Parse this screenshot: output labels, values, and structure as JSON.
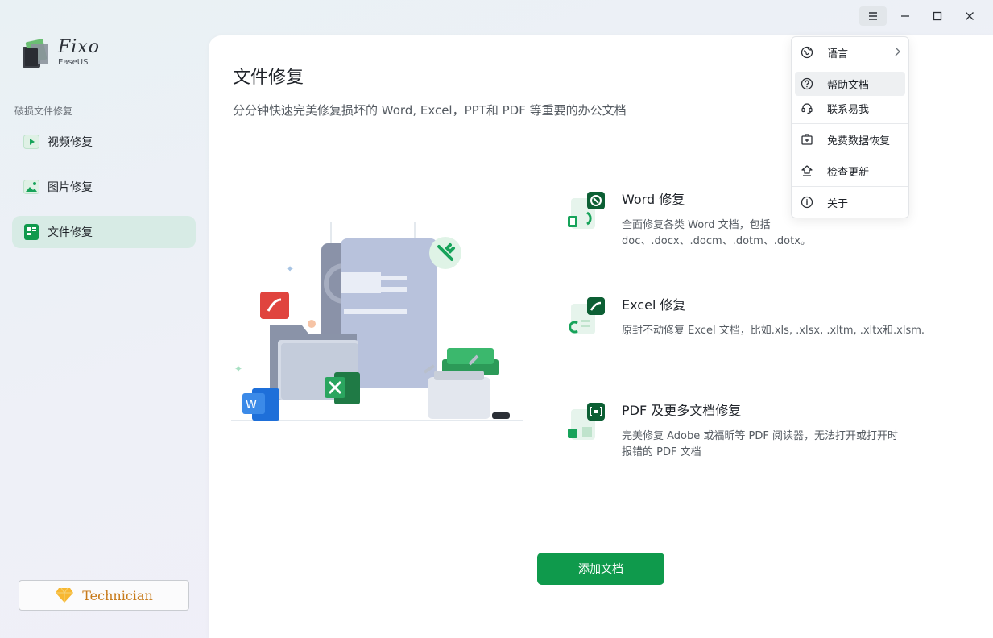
{
  "app": {
    "logo_title": "Fixo",
    "logo_sub": "EaseUS"
  },
  "sidebar": {
    "section_label": "破损文件修复",
    "items": [
      {
        "label": "视频修复",
        "icon": "video-icon"
      },
      {
        "label": "图片修复",
        "icon": "image-icon"
      },
      {
        "label": "文件修复",
        "icon": "document-icon"
      }
    ],
    "technician_label": "Technician"
  },
  "main": {
    "title": "文件修复",
    "subtitle": "分分钟快速完美修复损坏的 Word, Excel，PPT和 PDF 等重要的办公文档",
    "features": [
      {
        "title": "Word 修复",
        "desc_line1": "全面修复各类 Word 文档，包括",
        "desc_line2": "doc、.docx、.docm、.dotm、.dotx。"
      },
      {
        "title": "Excel 修复",
        "desc_line1": "原封不动修复 Excel 文档，比如.xls, .xlsx, .xltm, .xltx和.xlsm.",
        "desc_line2": ""
      },
      {
        "title": "PDF 及更多文档修复",
        "desc_line1": "完美修复 Adobe 或福昕等 PDF 阅读器，无法打开或打开时",
        "desc_line2": "报错的 PDF 文档"
      }
    ],
    "add_button": "添加文档"
  },
  "menu": {
    "items": [
      {
        "label": "语言",
        "icon": "globe-icon"
      },
      {
        "label": "帮助文档",
        "icon": "help-icon"
      },
      {
        "label": "联系易我",
        "icon": "headset-icon"
      },
      {
        "label": "免费数据恢复",
        "icon": "recovery-icon"
      },
      {
        "label": "检查更新",
        "icon": "update-icon"
      },
      {
        "label": "关于",
        "icon": "info-icon"
      }
    ]
  },
  "colors": {
    "accent": "#0f9a4c",
    "active_nav": "#d7ebe5",
    "technician": "#c77a1a"
  }
}
